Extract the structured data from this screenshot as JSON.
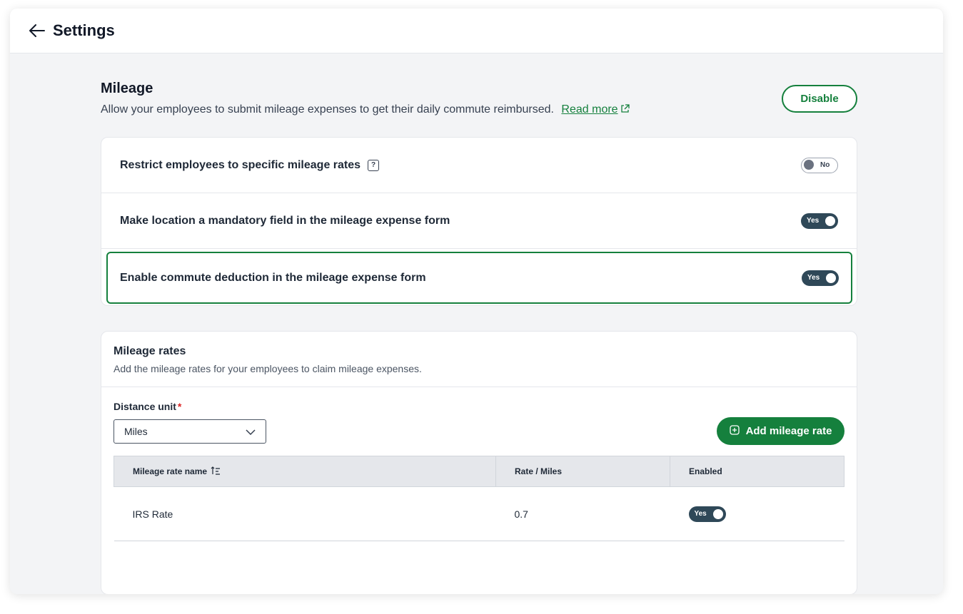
{
  "header": {
    "title": "Settings"
  },
  "mileage": {
    "title": "Mileage",
    "description": "Allow your employees to submit mileage expenses to get their daily commute reimbursed.",
    "read_more": "Read more",
    "disable_label": "Disable"
  },
  "settings": [
    {
      "label": "Restrict employees to specific mileage rates",
      "toggle": "No",
      "enabled": false,
      "has_help": true
    },
    {
      "label": "Make location a mandatory field in the mileage expense form",
      "toggle": "Yes",
      "enabled": true
    },
    {
      "label": "Enable commute deduction in the mileage expense form",
      "toggle": "Yes",
      "enabled": true,
      "highlighted": true
    }
  ],
  "help_icon": "?",
  "rates": {
    "title": "Mileage rates",
    "description": "Add the mileage rates for your employees to claim mileage expenses.",
    "distance_unit_label": "Distance unit",
    "required_mark": "*",
    "distance_unit_value": "Miles",
    "add_label": "Add mileage rate",
    "columns": [
      "Mileage rate name",
      "Rate / Miles",
      "Enabled"
    ],
    "rows": [
      {
        "name": "IRS Rate",
        "rate": "0.7",
        "enabled": "Yes"
      }
    ]
  },
  "colors": {
    "accent": "#15803d",
    "toggle_on": "#2f4858",
    "background": "#f3f4f6"
  }
}
